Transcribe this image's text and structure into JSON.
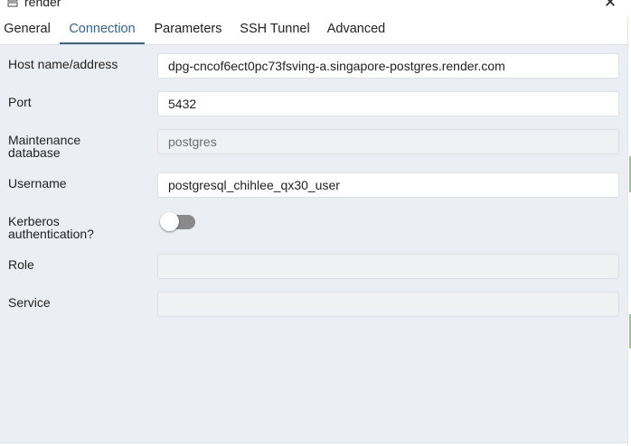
{
  "window": {
    "title": "render",
    "icon": "server-group-icon",
    "close_glyph": "✕"
  },
  "tabs": [
    {
      "label": "General",
      "active": false
    },
    {
      "label": "Connection",
      "active": true
    },
    {
      "label": "Parameters",
      "active": false
    },
    {
      "label": "SSH Tunnel",
      "active": false
    },
    {
      "label": "Advanced",
      "active": false
    }
  ],
  "form": {
    "host": {
      "label": "Host name/address",
      "value": "dpg-cncof6ect0pc73fsving-a.singapore-postgres.render.com"
    },
    "port": {
      "label": "Port",
      "value": "5432"
    },
    "maintenance_db": {
      "label_line1": "Maintenance",
      "label_line2": "database",
      "value": "postgres",
      "disabled": true
    },
    "username": {
      "label": "Username",
      "value": "postgresql_chihlee_qx30_user"
    },
    "kerberos": {
      "label_line1": "Kerberos",
      "label_line2": "authentication?",
      "enabled": false
    },
    "role": {
      "label": "Role",
      "value": ""
    },
    "service": {
      "label": "Service",
      "value": ""
    }
  },
  "colors": {
    "accent": "#326690",
    "panel_bg": "#ebeef3",
    "toggle_off": "#8a8a8a"
  }
}
